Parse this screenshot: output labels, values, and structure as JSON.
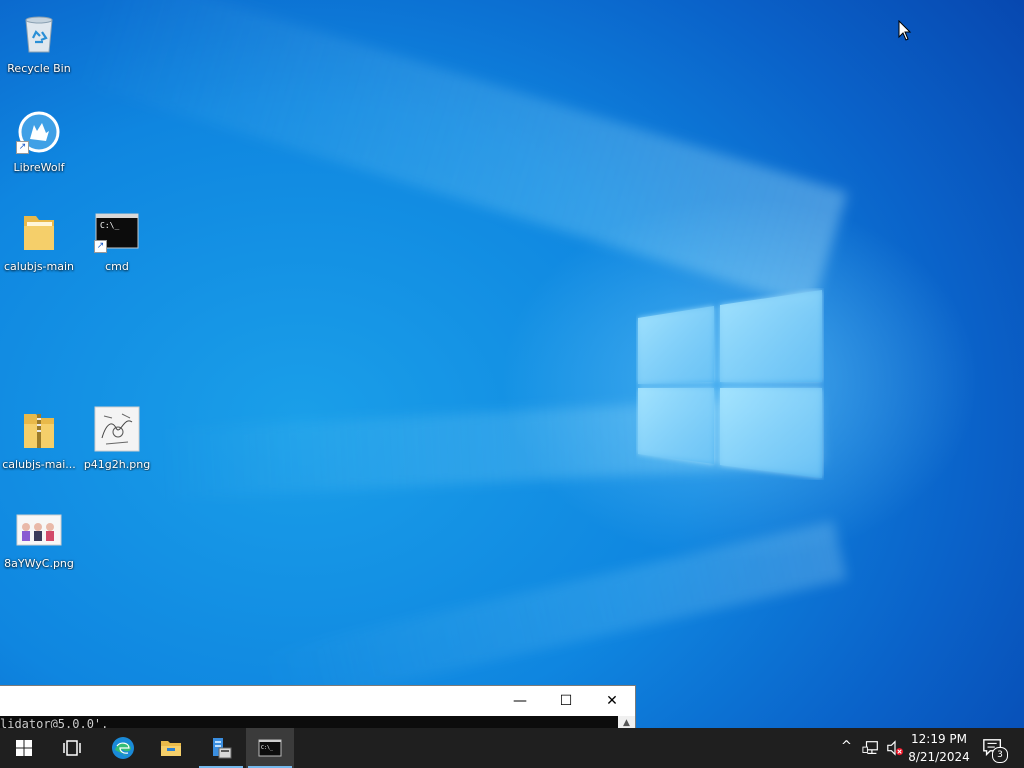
{
  "desktop": {
    "icons": [
      {
        "label": "Recycle Bin",
        "icon": "recycle-bin-icon"
      },
      {
        "label": "LibreWolf",
        "icon": "librewolf-icon"
      },
      {
        "label": "calubjs-main",
        "icon": "folder-icon"
      },
      {
        "label": "cmd",
        "icon": "cmd-icon"
      },
      {
        "label": "calubjs-mai...",
        "icon": "zip-folder-icon"
      },
      {
        "label": "p41g2h.png",
        "icon": "image-file-icon"
      },
      {
        "label": "8aYWyC.png",
        "icon": "image-file-icon"
      }
    ]
  },
  "console": {
    "line": "lidator@5.0.0'.",
    "minimize_glyph": "—",
    "maximize_glyph": "☐",
    "close_glyph": "✕",
    "scroll_glyph": "▲"
  },
  "taskbar": {
    "start": "start-icon",
    "task_view": "task-view-icon",
    "apps": [
      {
        "name": "Microsoft Edge",
        "icon": "edge-icon",
        "open": false
      },
      {
        "name": "File Explorer",
        "icon": "file-explorer-icon",
        "open": false
      },
      {
        "name": "Server Manager",
        "icon": "server-manager-icon",
        "open": true
      },
      {
        "name": "Command Prompt",
        "icon": "cmd-icon",
        "open": true,
        "active": true
      }
    ],
    "tray": {
      "chevron": "^",
      "time": "12:19 PM",
      "date": "8/21/2024",
      "notifications": "3"
    }
  },
  "colors": {
    "taskbar": "#1f1f1f",
    "accent": "#76b9ed",
    "desktop": "#0f86e0"
  }
}
